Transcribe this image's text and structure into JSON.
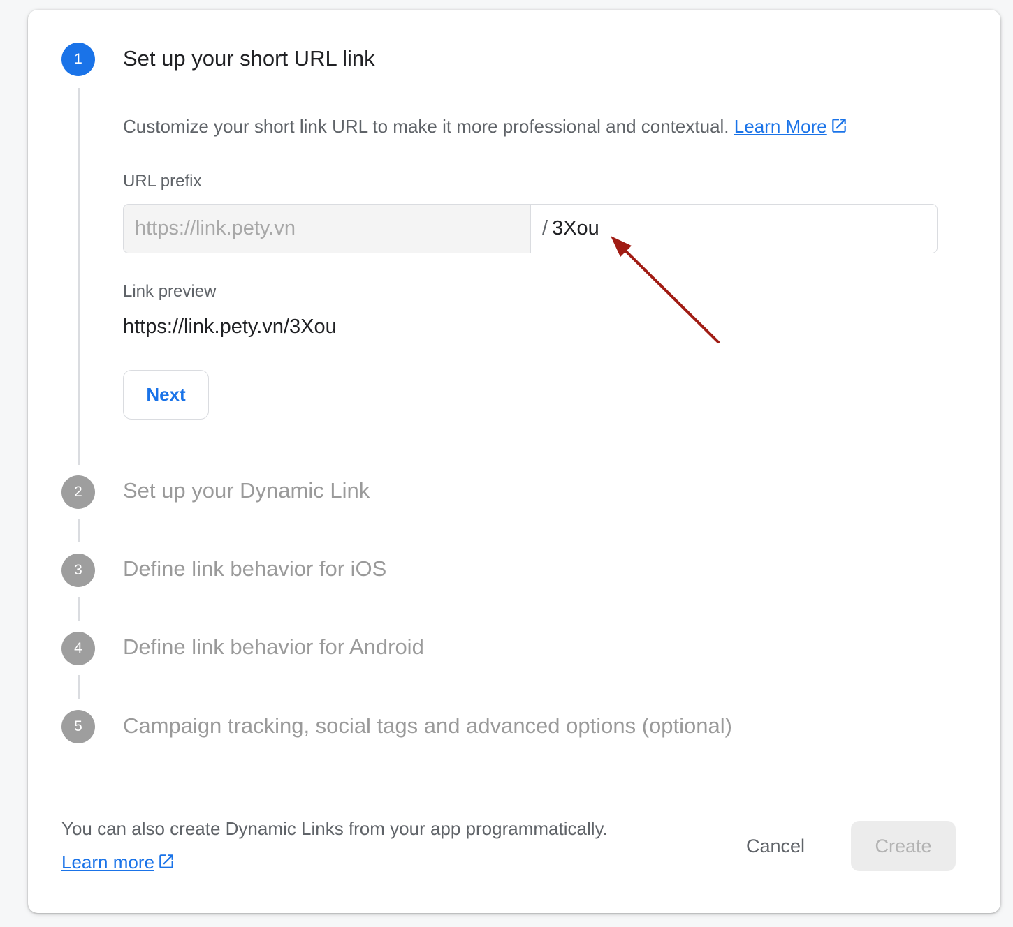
{
  "steps": [
    {
      "number": "1",
      "title": "Set up your short URL link",
      "active": true
    },
    {
      "number": "2",
      "title": "Set up your Dynamic Link",
      "active": false
    },
    {
      "number": "3",
      "title": "Define link behavior for iOS",
      "active": false
    },
    {
      "number": "4",
      "title": "Define link behavior for Android",
      "active": false
    },
    {
      "number": "5",
      "title": "Campaign tracking, social tags and advanced options (optional)",
      "active": false
    }
  ],
  "step1": {
    "description": "Customize your short link URL to make it more professional and contextual.",
    "learn_more_label": "Learn More",
    "url_prefix_label": "URL prefix",
    "url_prefix_value": "https://link.pety.vn",
    "slash": "/",
    "suffix_value": "3Xou",
    "link_preview_label": "Link preview",
    "link_preview_value": "https://link.pety.vn/3Xou",
    "next_label": "Next"
  },
  "footer": {
    "text": "You can also create Dynamic Links from your app programmatically.",
    "learn_more_label": "Learn more",
    "cancel_label": "Cancel",
    "create_label": "Create"
  },
  "icons": {
    "external_link": "open-in-new-icon"
  },
  "colors": {
    "accent": "#1a73e8",
    "inactive_step": "#9e9e9e",
    "annotation_arrow": "#a01c14"
  }
}
